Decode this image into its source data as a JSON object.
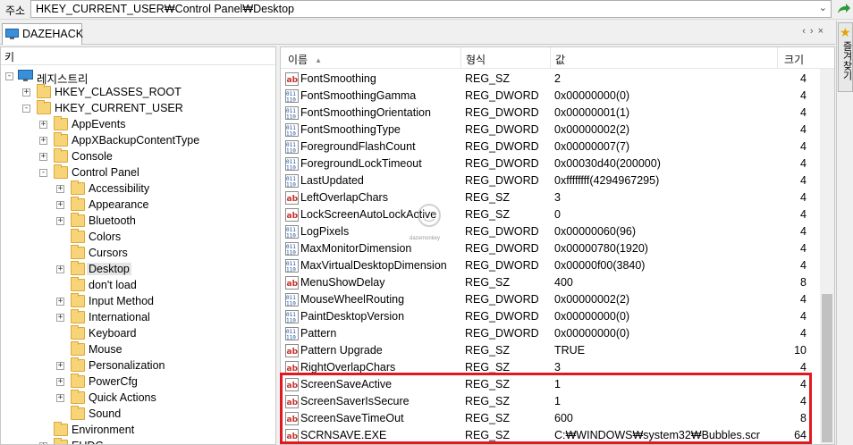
{
  "address": {
    "label": "주소",
    "path": "HKEY_CURRENT_USER₩Control Panel₩Desktop"
  },
  "tab": {
    "label": "DAZEHACK"
  },
  "favorites": {
    "label": "즐겨찾기"
  },
  "tree": {
    "header": "키",
    "root": "레지스트리",
    "nodes": [
      {
        "label": "HKEY_CLASSES_ROOT",
        "level": 1,
        "exp": "+"
      },
      {
        "label": "HKEY_CURRENT_USER",
        "level": 1,
        "exp": "-"
      },
      {
        "label": "AppEvents",
        "level": 2,
        "exp": "+"
      },
      {
        "label": "AppXBackupContentType",
        "level": 2,
        "exp": "+"
      },
      {
        "label": "Console",
        "level": 2,
        "exp": "+"
      },
      {
        "label": "Control Panel",
        "level": 2,
        "exp": "-"
      },
      {
        "label": "Accessibility",
        "level": 3,
        "exp": "+"
      },
      {
        "label": "Appearance",
        "level": 3,
        "exp": "+"
      },
      {
        "label": "Bluetooth",
        "level": 3,
        "exp": "+"
      },
      {
        "label": "Colors",
        "level": 3,
        "exp": ""
      },
      {
        "label": "Cursors",
        "level": 3,
        "exp": ""
      },
      {
        "label": "Desktop",
        "level": 3,
        "exp": "+",
        "selected": true
      },
      {
        "label": "don't load",
        "level": 3,
        "exp": ""
      },
      {
        "label": "Input Method",
        "level": 3,
        "exp": "+"
      },
      {
        "label": "International",
        "level": 3,
        "exp": "+"
      },
      {
        "label": "Keyboard",
        "level": 3,
        "exp": ""
      },
      {
        "label": "Mouse",
        "level": 3,
        "exp": ""
      },
      {
        "label": "Personalization",
        "level": 3,
        "exp": "+"
      },
      {
        "label": "PowerCfg",
        "level": 3,
        "exp": "+"
      },
      {
        "label": "Quick Actions",
        "level": 3,
        "exp": "+"
      },
      {
        "label": "Sound",
        "level": 3,
        "exp": ""
      },
      {
        "label": "Environment",
        "level": 2,
        "exp": ""
      },
      {
        "label": "EUDC",
        "level": 2,
        "exp": "+"
      }
    ]
  },
  "list": {
    "columns": {
      "name": "이름",
      "type": "형식",
      "value": "값",
      "size": "크기"
    },
    "rows": [
      {
        "name": "FontSmoothing",
        "type": "REG_SZ",
        "value": "2",
        "size": "4",
        "icon": "string"
      },
      {
        "name": "FontSmoothingGamma",
        "type": "REG_DWORD",
        "value": "0x00000000(0)",
        "size": "4",
        "icon": "binary"
      },
      {
        "name": "FontSmoothingOrientation",
        "type": "REG_DWORD",
        "value": "0x00000001(1)",
        "size": "4",
        "icon": "binary"
      },
      {
        "name": "FontSmoothingType",
        "type": "REG_DWORD",
        "value": "0x00000002(2)",
        "size": "4",
        "icon": "binary"
      },
      {
        "name": "ForegroundFlashCount",
        "type": "REG_DWORD",
        "value": "0x00000007(7)",
        "size": "4",
        "icon": "binary"
      },
      {
        "name": "ForegroundLockTimeout",
        "type": "REG_DWORD",
        "value": "0x00030d40(200000)",
        "size": "4",
        "icon": "binary"
      },
      {
        "name": "LastUpdated",
        "type": "REG_DWORD",
        "value": "0xffffffff(4294967295)",
        "size": "4",
        "icon": "binary"
      },
      {
        "name": "LeftOverlapChars",
        "type": "REG_SZ",
        "value": "3",
        "size": "4",
        "icon": "string"
      },
      {
        "name": "LockScreenAutoLockActive",
        "type": "REG_SZ",
        "value": "0",
        "size": "4",
        "icon": "string"
      },
      {
        "name": "LogPixels",
        "type": "REG_DWORD",
        "value": "0x00000060(96)",
        "size": "4",
        "icon": "binary"
      },
      {
        "name": "MaxMonitorDimension",
        "type": "REG_DWORD",
        "value": "0x00000780(1920)",
        "size": "4",
        "icon": "binary"
      },
      {
        "name": "MaxVirtualDesktopDimension",
        "type": "REG_DWORD",
        "value": "0x00000f00(3840)",
        "size": "4",
        "icon": "binary"
      },
      {
        "name": "MenuShowDelay",
        "type": "REG_SZ",
        "value": "400",
        "size": "8",
        "icon": "string"
      },
      {
        "name": "MouseWheelRouting",
        "type": "REG_DWORD",
        "value": "0x00000002(2)",
        "size": "4",
        "icon": "binary"
      },
      {
        "name": "PaintDesktopVersion",
        "type": "REG_DWORD",
        "value": "0x00000000(0)",
        "size": "4",
        "icon": "binary"
      },
      {
        "name": "Pattern",
        "type": "REG_DWORD",
        "value": "0x00000000(0)",
        "size": "4",
        "icon": "binary"
      },
      {
        "name": "Pattern Upgrade",
        "type": "REG_SZ",
        "value": "TRUE",
        "size": "10",
        "icon": "string"
      },
      {
        "name": "RightOverlapChars",
        "type": "REG_SZ",
        "value": "3",
        "size": "4",
        "icon": "string"
      },
      {
        "name": "ScreenSaveActive",
        "type": "REG_SZ",
        "value": "1",
        "size": "4",
        "icon": "string"
      },
      {
        "name": "ScreenSaverIsSecure",
        "type": "REG_SZ",
        "value": "1",
        "size": "4",
        "icon": "string"
      },
      {
        "name": "ScreenSaveTimeOut",
        "type": "REG_SZ",
        "value": "600",
        "size": "8",
        "icon": "string"
      },
      {
        "name": "SCRNSAVE.EXE",
        "type": "REG_SZ",
        "value": "C:₩WINDOWS₩system32₩Bubbles.scr",
        "size": "64",
        "icon": "string"
      }
    ]
  },
  "watermark": {
    "text": "dazemonkey"
  },
  "colors": {
    "highlight": "#e0191e",
    "selection": "#e5e5e5",
    "folder": "#f7d478"
  }
}
